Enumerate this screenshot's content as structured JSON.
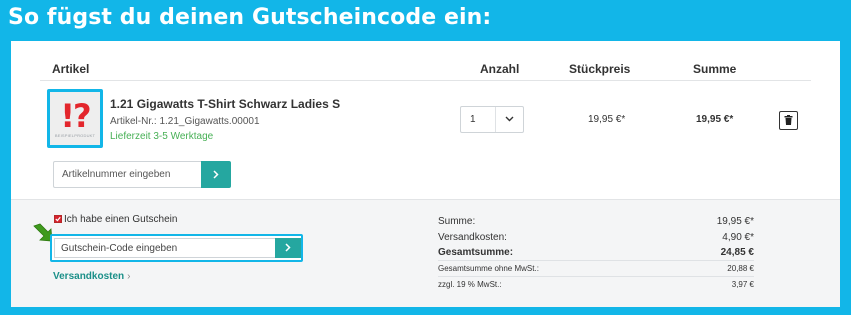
{
  "banner": {
    "title": "So fügst du deinen Gutscheincode ein:"
  },
  "colors": {
    "accent_blue": "#12b6e8",
    "button_teal": "#25a7a0",
    "delivery_green": "#47b055",
    "product_red": "#e3262c"
  },
  "table": {
    "headers": {
      "article": "Artikel",
      "quantity": "Anzahl",
      "unit_price": "Stückpreis",
      "total": "Summe"
    }
  },
  "item": {
    "thumb_mark": "!?",
    "thumb_caption": "BEISPIELPRODUKT",
    "name": "1.21 Gigawatts T-Shirt Schwarz Ladies S",
    "article_number": "Artikel-Nr.: 1.21_Gigawatts.00001",
    "delivery": "Lieferzeit 3-5 Werktage",
    "quantity": "1",
    "unit_price": "19,95 €*",
    "total": "19,95 €*",
    "delete_icon": "trash-icon"
  },
  "article_input": {
    "placeholder": "Artikelnummer eingeben",
    "button_icon": "chevron-right-icon"
  },
  "coupon": {
    "checkbox_label": "Ich habe einen Gutschein",
    "checked": true,
    "placeholder": "Gutschein-Code eingeben",
    "pointer_icon": "green-arrow-icon"
  },
  "shipping_link": "Versandkosten",
  "summary": {
    "subtotal_label": "Summe:",
    "subtotal": "19,95 €*",
    "shipping_label": "Versandkosten:",
    "shipping": "4,90 €*",
    "grand_label": "Gesamtsumme:",
    "grand": "24,85 €",
    "net_label": "Gesamtsumme ohne MwSt.:",
    "net": "20,88 €",
    "vat_label": "zzgl. 19 % MwSt.:",
    "vat": "3,97 €"
  }
}
